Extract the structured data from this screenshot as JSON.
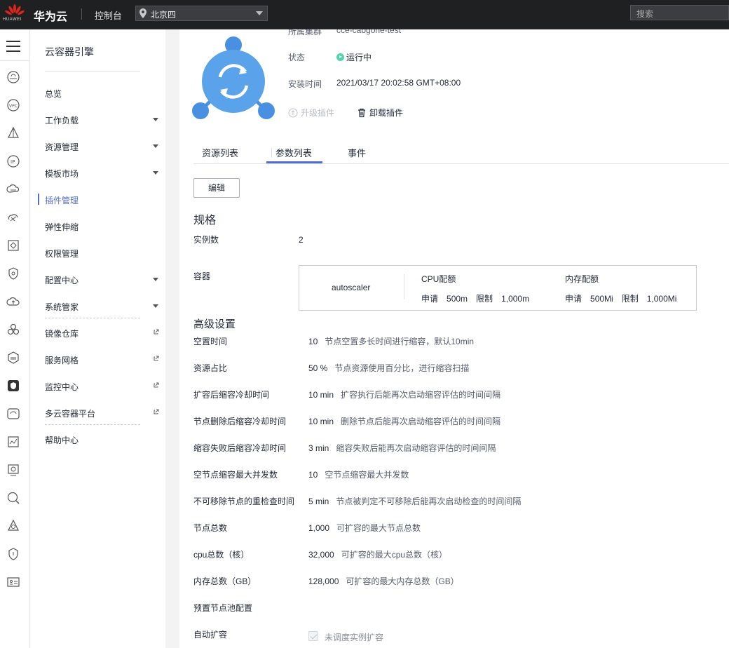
{
  "topbar": {
    "logo_text": "HUAWEI",
    "brand": "华为云",
    "console": "控制台",
    "region": "北京四",
    "search_placeholder": "搜索"
  },
  "sidebar": {
    "title": "云容器引擎",
    "items": [
      {
        "label": "总览"
      },
      {
        "label": "工作负载",
        "expand": true
      },
      {
        "label": "资源管理",
        "expand": true
      },
      {
        "label": "模板市场",
        "expand": true
      },
      {
        "label": "插件管理",
        "active": true
      },
      {
        "label": "弹性伸缩"
      },
      {
        "label": "权限管理"
      },
      {
        "label": "配置中心",
        "expand": true
      },
      {
        "label": "系统管家",
        "expand": true
      },
      {
        "label": "镜像仓库",
        "external": true
      },
      {
        "label": "服务网格",
        "external": true
      },
      {
        "label": "监控中心",
        "external": true
      },
      {
        "label": "多云容器平台",
        "external": true
      },
      {
        "label": "帮助中心"
      }
    ]
  },
  "plugin": {
    "cluster_label": "所属集群",
    "cluster_value": "cce-cabgone-test",
    "status_label": "状态",
    "status_value": "运行中",
    "status_color": "#50d4ab",
    "install_time_label": "安装时间",
    "install_time_value": "2021/03/17 20:02:58 GMT+08:00",
    "upgrade_label": "升级插件",
    "uninstall_label": "卸载插件"
  },
  "tabs": [
    {
      "label": "资源列表"
    },
    {
      "label": "参数列表",
      "active": true
    },
    {
      "label": "事件"
    }
  ],
  "edit_button": "编辑",
  "spec": {
    "title": "规格",
    "instances_label": "实例数",
    "instances_value": "2",
    "container_label": "容器",
    "container": {
      "name": "autoscaler",
      "cpu_title": "CPU配额",
      "cpu_request_label": "申请",
      "cpu_request": "500m",
      "cpu_limit_label": "限制",
      "cpu_limit": "1,000m",
      "mem_title": "内存配额",
      "mem_request_label": "申请",
      "mem_request": "500Mi",
      "mem_limit_label": "限制",
      "mem_limit": "1,000Mi"
    }
  },
  "advanced": {
    "title": "高级设置",
    "rows": [
      {
        "label": "空置时间",
        "value": "10",
        "desc": "节点空置多长时间进行缩容，默认10min"
      },
      {
        "label": "资源占比",
        "value": "50 %",
        "desc": "节点资源使用百分比，进行缩容扫描"
      },
      {
        "label": "扩容后缩容冷却时间",
        "value": "10 min",
        "desc": "扩容执行后能再次启动缩容评估的时间间隔"
      },
      {
        "label": "节点删除后缩容冷却时间",
        "value": "10 min",
        "desc": "删除节点后能再次启动缩容评估的时间间隔"
      },
      {
        "label": "缩容失败后缩容冷却时间",
        "value": "3 min",
        "desc": "缩容失败后能再次启动缩容评估的时间间隔"
      },
      {
        "label": "空节点缩容最大并发数",
        "value": "10",
        "desc": "空节点缩容最大并发数"
      },
      {
        "label": "不可移除节点的重检查时间",
        "value": "5 min",
        "desc": "节点被判定不可移除后能再次启动检查的时间间隔"
      },
      {
        "label": "节点总数",
        "value": "1,000",
        "desc": "可扩容的最大节点总数"
      },
      {
        "label": "cpu总数（核）",
        "value": "32,000",
        "desc": "可扩容的最大cpu总数（核）"
      },
      {
        "label": "内存总数（GB）",
        "value": "128,000",
        "desc": "可扩容的最大内存总数（GB）"
      }
    ],
    "node_pool_label": "预置节点池配置",
    "auto_scale_label": "自动扩容",
    "auto_scale_option": "未调度实例扩容"
  }
}
